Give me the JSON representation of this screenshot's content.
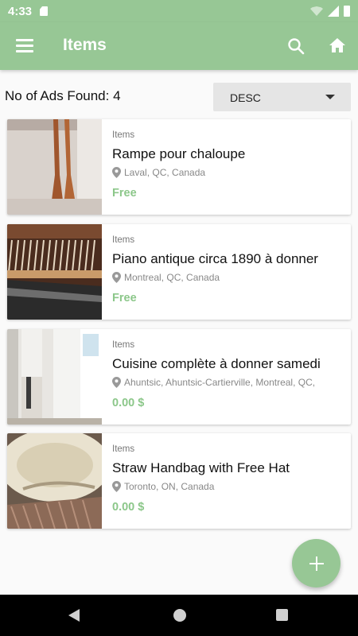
{
  "status_bar": {
    "time": "4:33",
    "icons": [
      "sd-card-icon",
      "wifi-icon",
      "signal-icon",
      "battery-icon"
    ]
  },
  "app_bar": {
    "title": "Items",
    "icons": [
      "menu-icon",
      "search-icon",
      "home-icon"
    ],
    "color": "#97c795"
  },
  "summary": {
    "ads_found": "No of Ads Found: 4"
  },
  "sort": {
    "selected": "DESC"
  },
  "items": [
    {
      "category": "Items",
      "title": "Rampe pour chaloupe",
      "location": "Laval, QC, Canada",
      "price": "Free",
      "image": "oars-photo"
    },
    {
      "category": "Items",
      "title": "Piano antique circa 1890 à donner",
      "location": "Montreal, QC, Canada",
      "price": "Free",
      "image": "piano-photo"
    },
    {
      "category": "Items",
      "title": "Cuisine complète à donner samedi",
      "location": "Ahuntsic, Ahuntsic-Cartierville, Montreal, QC,",
      "price": "0.00 $",
      "image": "kitchen-photo"
    },
    {
      "category": "Items",
      "title": "Straw Handbag with Free Hat",
      "location": "Toronto, ON, Canada",
      "price": "0.00 $",
      "image": "straw-bag-photo"
    }
  ],
  "fab": {
    "icon": "plus-icon"
  },
  "nav_bar": {
    "icons": [
      "back-icon",
      "home-nav-icon",
      "recents-icon"
    ]
  },
  "colors": {
    "accent": "#97c795",
    "price": "#8cc78a",
    "background": "#fafafa"
  }
}
